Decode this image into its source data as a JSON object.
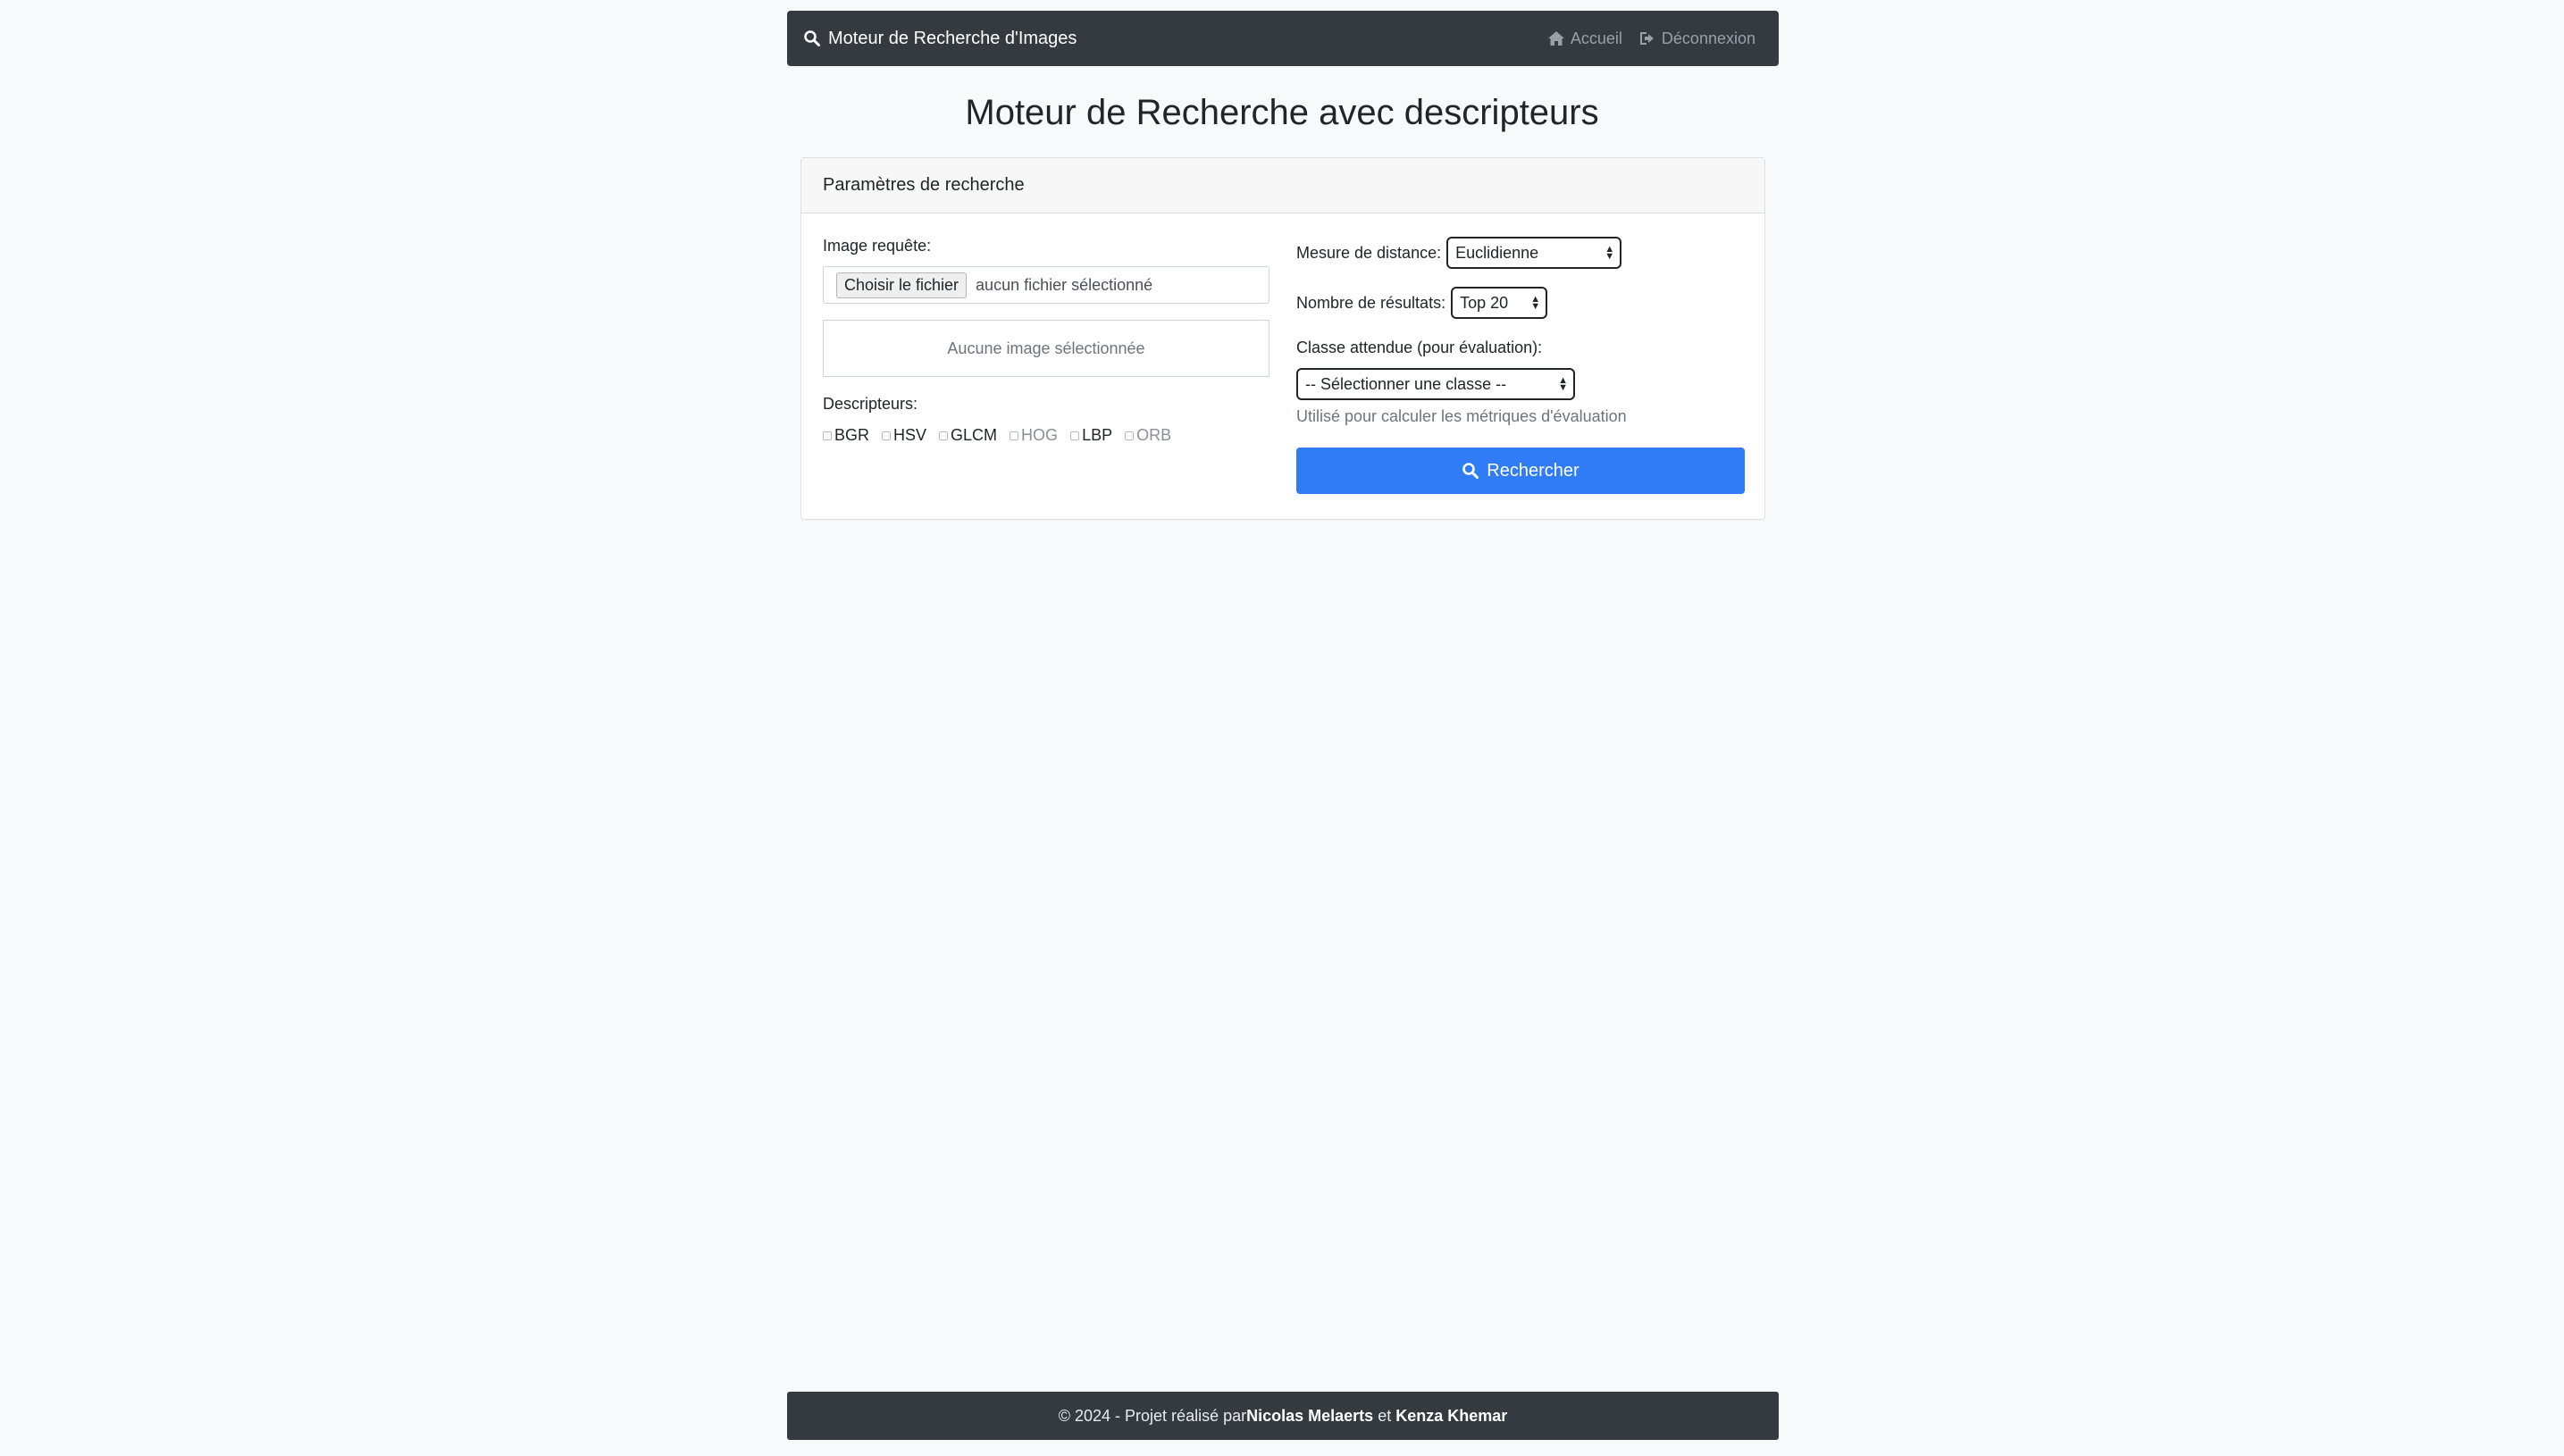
{
  "navbar": {
    "brand": "Moteur de Recherche d'Images",
    "links": [
      {
        "label": "Accueil",
        "icon": "home-icon"
      },
      {
        "label": "Déconnexion",
        "icon": "sign-out-icon"
      }
    ]
  },
  "page": {
    "title": "Moteur de Recherche avec descripteurs"
  },
  "card": {
    "header": "Paramètres de recherche",
    "query_image_label": "Image requête:",
    "file_button": "Choisir le fichier",
    "file_status": "aucun fichier sélectionné",
    "preview_placeholder": "Aucune image sélectionnée",
    "descriptors_label": "Descripteurs:",
    "descriptors": [
      {
        "label": "BGR",
        "checked": false,
        "enabled": true
      },
      {
        "label": "HSV",
        "checked": false,
        "enabled": true
      },
      {
        "label": "GLCM",
        "checked": false,
        "enabled": true
      },
      {
        "label": "HOG",
        "checked": false,
        "enabled": false
      },
      {
        "label": "LBP",
        "checked": false,
        "enabled": true
      },
      {
        "label": "ORB",
        "checked": false,
        "enabled": false
      }
    ],
    "distance_label": "Mesure de distance:",
    "distance_value": "Euclidienne",
    "results_label": "Nombre de résultats:",
    "results_value": "Top 20",
    "class_label": "Classe attendue (pour évaluation):",
    "class_value": "-- Sélectionner une classe --",
    "class_help": "Utilisé pour calculer les métriques d'évaluation",
    "search_button": "Rechercher"
  },
  "footer": {
    "prefix": "© 2024 - Projet réalisé par ",
    "author1": "Nicolas Melaerts",
    "conj": " et ",
    "author2": "Kenza Khemar"
  },
  "colors": {
    "navbar_bg": "#343a40",
    "primary": "#2f7cf6",
    "page_bg": "#f8f9fa"
  }
}
